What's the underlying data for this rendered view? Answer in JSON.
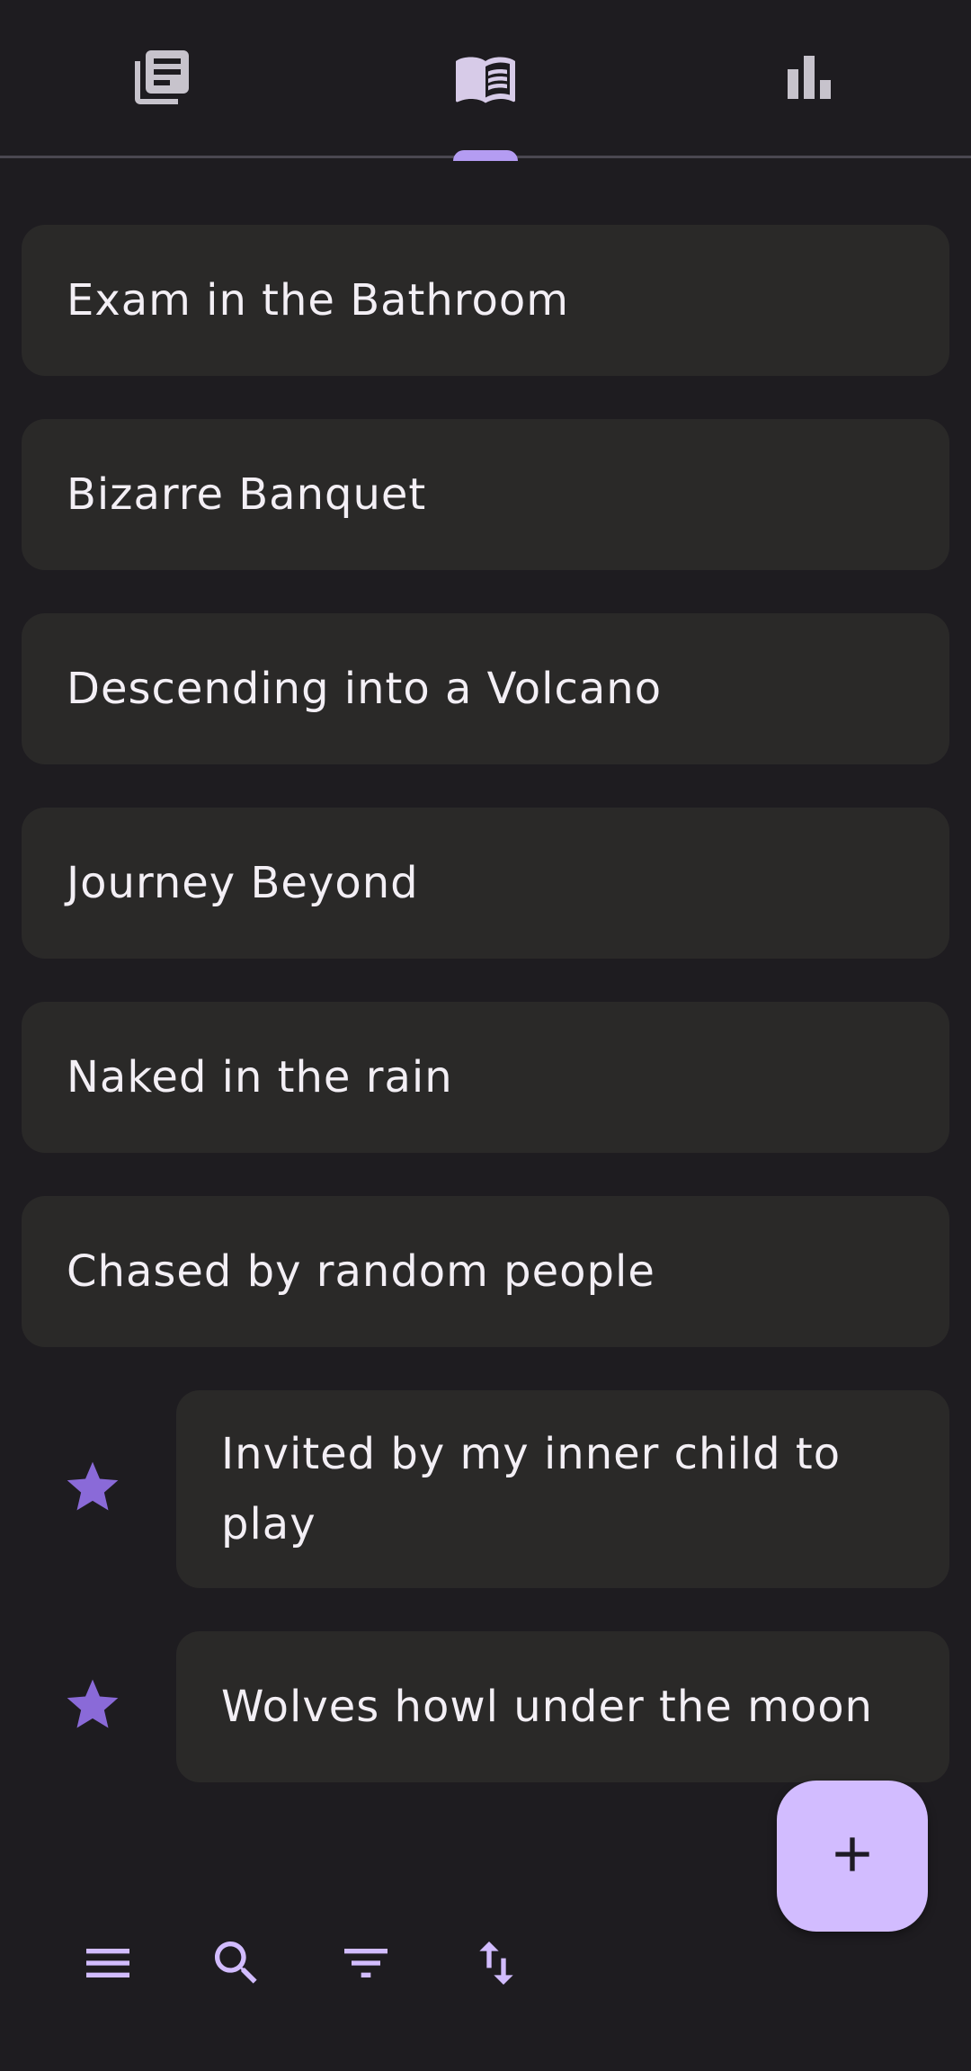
{
  "colors": {
    "background": "#1e1c20",
    "card": "#2a2928",
    "accent": "#b49cf2",
    "fab": "#d2bcff",
    "icon_muted": "#c7c3cc",
    "text": "#f3eff5"
  },
  "tabs": [
    {
      "icon": "journal-list-icon",
      "selected": false
    },
    {
      "icon": "open-book-icon",
      "selected": true
    },
    {
      "icon": "bar-chart-icon",
      "selected": false
    }
  ],
  "dreams": [
    {
      "title": "Exam in the Bathroom",
      "starred": false
    },
    {
      "title": "Bizarre Banquet",
      "starred": false
    },
    {
      "title": "Descending into a Volcano",
      "starred": false
    },
    {
      "title": "Journey Beyond",
      "starred": false
    },
    {
      "title": "Naked in the rain",
      "starred": false
    },
    {
      "title": "Chased by random people",
      "starred": false
    },
    {
      "title": "Invited by my inner child to play",
      "starred": true
    },
    {
      "title": "Wolves howl under the moon",
      "starred": true
    }
  ],
  "fab": {
    "icon": "plus-icon"
  },
  "toolbar": [
    {
      "icon": "menu-icon"
    },
    {
      "icon": "search-icon"
    },
    {
      "icon": "filter-icon"
    },
    {
      "icon": "sort-icon"
    }
  ]
}
